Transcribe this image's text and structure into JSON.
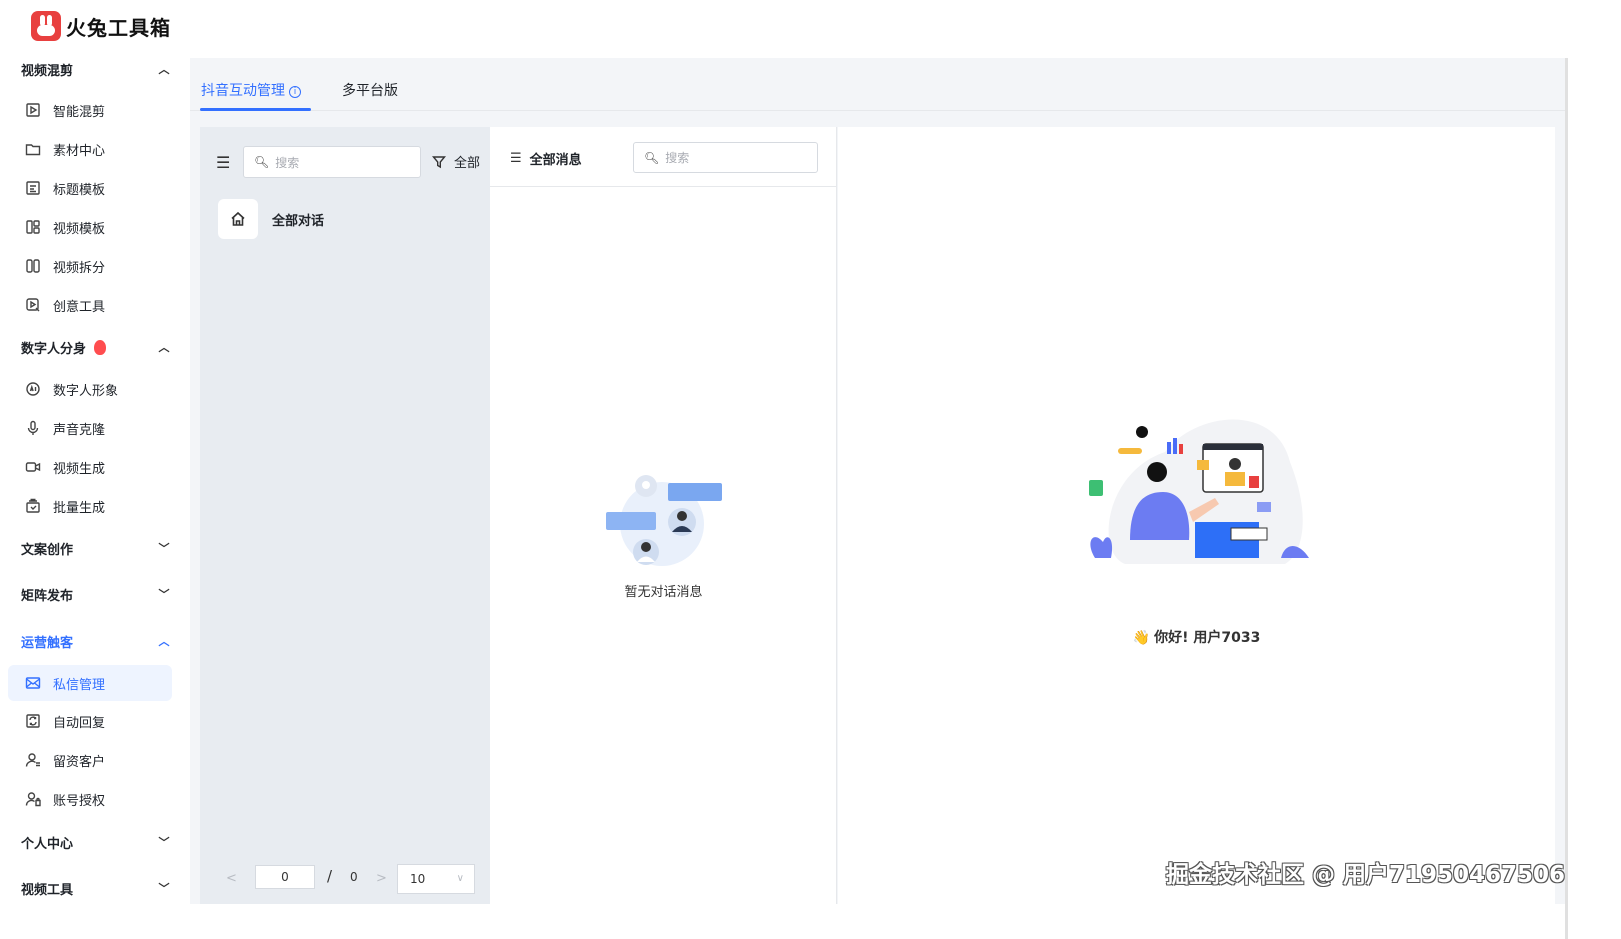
{
  "app": {
    "name": "火兔工具箱"
  },
  "sidebar": {
    "groups": [
      {
        "label": "视频混剪",
        "expanded": true,
        "items": [
          "智能混剪",
          "素材中心",
          "标题模板",
          "视频模板",
          "视频拆分",
          "创意工具"
        ]
      },
      {
        "label": "数字人分身",
        "expanded": true,
        "badge": "fire-icon",
        "items": [
          "数字人形象",
          "声音克隆",
          "视频生成",
          "批量生成"
        ]
      },
      {
        "label": "文案创作",
        "expanded": false
      },
      {
        "label": "矩阵发布",
        "expanded": false
      },
      {
        "label": "运营触客",
        "expanded": true,
        "active": true,
        "items": [
          "私信管理",
          "自动回复",
          "留资客户",
          "账号授权"
        ],
        "active_item": "私信管理"
      },
      {
        "label": "个人中心",
        "expanded": false
      },
      {
        "label": "视频工具",
        "expanded": false
      }
    ]
  },
  "tabs": [
    {
      "label": "抖音互动管理",
      "active": true,
      "info_icon": "i"
    },
    {
      "label": "多平台版",
      "active": false
    }
  ],
  "conversations": {
    "search_placeholder": "搜索",
    "filter_label": "全部",
    "items": [
      {
        "label": "全部对话",
        "icon": "home-icon"
      }
    ],
    "pager": {
      "current": "0",
      "total": "0",
      "separator": "/",
      "page_size": "10",
      "prev": "<",
      "next": ">",
      "dropdown": "∨"
    }
  },
  "messages": {
    "title": "全部消息",
    "search_placeholder": "搜索",
    "empty_text": "暂无对话消息"
  },
  "detail": {
    "greeting": "你好! 用户7033",
    "wave_icon": "👋"
  },
  "watermark": "掘金技术社区 @ 用户71950467506",
  "colors": {
    "accent": "#3370ff",
    "brand": "#e8403f",
    "panel_bg": "#e8ecf1",
    "main_bg": "#f3f5f8"
  }
}
